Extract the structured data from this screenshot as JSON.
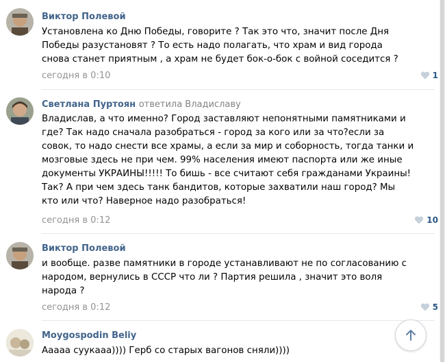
{
  "comments": [
    {
      "author": "Виктор Полевой",
      "reply_to": "",
      "lines": [
        "Установлена ко Дню Победы, говорите ? Так это что, значит после Дня",
        "Победы разустановят ? То есть надо полагать, что храм и вид города",
        "снова станет приятным , а храм не будет бок-о-бок с войной соседится ?"
      ],
      "time": "сегодня в 0:10",
      "likes": "1"
    },
    {
      "author": "Светлана Пуртоян",
      "reply_to": "ответила Владиславу",
      "lines": [
        "Владислав, а что именно? Город заставляют непонятными памятниками и",
        "где? Так надо сначала разобраться - город за кого или за что?если за",
        "совок, то надо снести все храмы, а если за мир и соборность, тогда танки и",
        "мозговые здесь не при чем. 99% населения имеют паспорта или же иные",
        "документы УКРАИНЫ!!!!! То бишь - все считают себя гражданами Украины!",
        "Так? А при чем здесь танк бандитов, которые захватили наш город? Мы",
        "кто или что? Наверное надо разобраться!"
      ],
      "time": "сегодня в 0:12",
      "likes": "10"
    },
    {
      "author": "Виктор Полевой",
      "reply_to": "",
      "lines": [
        "и вообще. разве памятники в городе устанавливают не по согласованию с",
        "народом, вернулись в СССР что ли ? Партия решила , значит это воля",
        "народа ?"
      ],
      "time": "сегодня в 0:12",
      "likes": "5"
    },
    {
      "author": "Moygospodin Beliy",
      "reply_to": "",
      "lines": [
        "Ааааа суукааа)))) Герб со старых вагонов сняли))))"
      ],
      "time": "",
      "likes": ""
    }
  ],
  "icons": {
    "like": "heart-icon",
    "scroll_up": "arrow-up-icon"
  },
  "colors": {
    "author": "#42648b",
    "meta": "#939393",
    "likes": "#2a5885",
    "separator": "#e7e8ec"
  }
}
